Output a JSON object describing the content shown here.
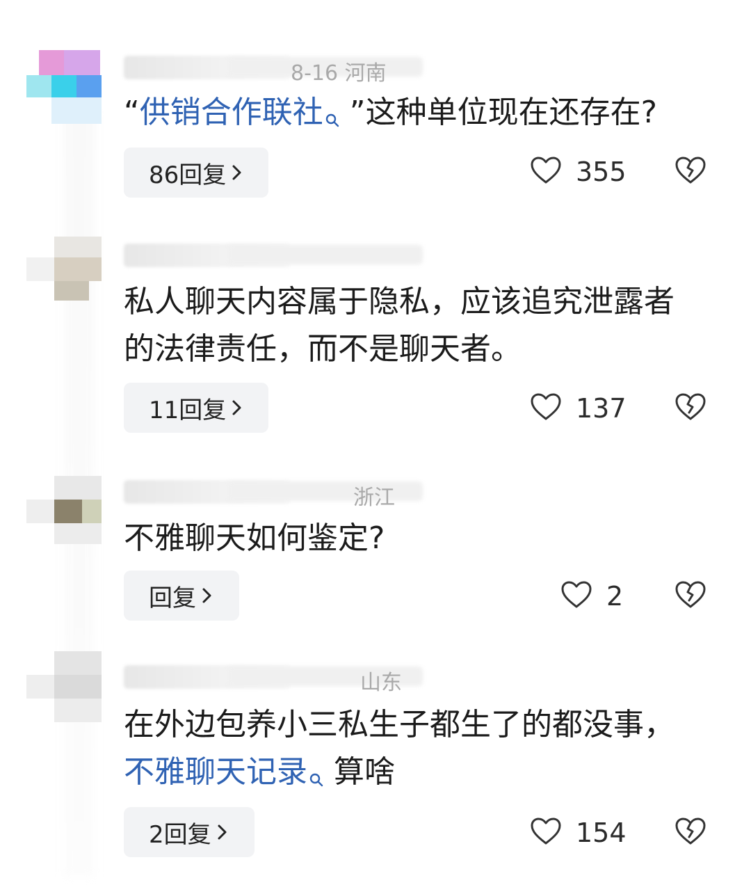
{
  "comments": [
    {
      "meta_text": "8-16 河南",
      "content_parts": [
        {
          "text": "“",
          "link": false
        },
        {
          "text": "供销合作联社",
          "link": true,
          "search": true
        },
        {
          "text": " ”这种单位现在还存在?",
          "link": false
        }
      ],
      "reply_label": "86回复",
      "likes": "355"
    },
    {
      "meta_text": "",
      "content_parts": [
        {
          "text": "私人聊天内容属于隐私，应该追究泄露者的法律责任，而不是聊天者。",
          "link": false
        }
      ],
      "reply_label": "11回复",
      "likes": "137"
    },
    {
      "meta_text": "浙江",
      "content_parts": [
        {
          "text": "不雅聊天如何鉴定?",
          "link": false
        }
      ],
      "reply_label": "回复",
      "likes": "2"
    },
    {
      "meta_text": "山东",
      "content_parts": [
        {
          "text": "在外边包养小三私生子都生了的都没事，",
          "link": false
        },
        {
          "text": "不雅聊天记录",
          "link": true,
          "search": true
        },
        {
          "text": " 算啥",
          "link": false
        }
      ],
      "reply_label": "2回复",
      "likes": "154"
    }
  ],
  "icons": {
    "like": "heart-outline-icon",
    "dislike": "broken-heart-icon",
    "chevron": "chevron-right-icon",
    "search": "search-small-icon"
  },
  "colors": {
    "link": "#2f62b3",
    "reply_bg": "#f2f3f5",
    "meta": "#a9a9a9"
  }
}
